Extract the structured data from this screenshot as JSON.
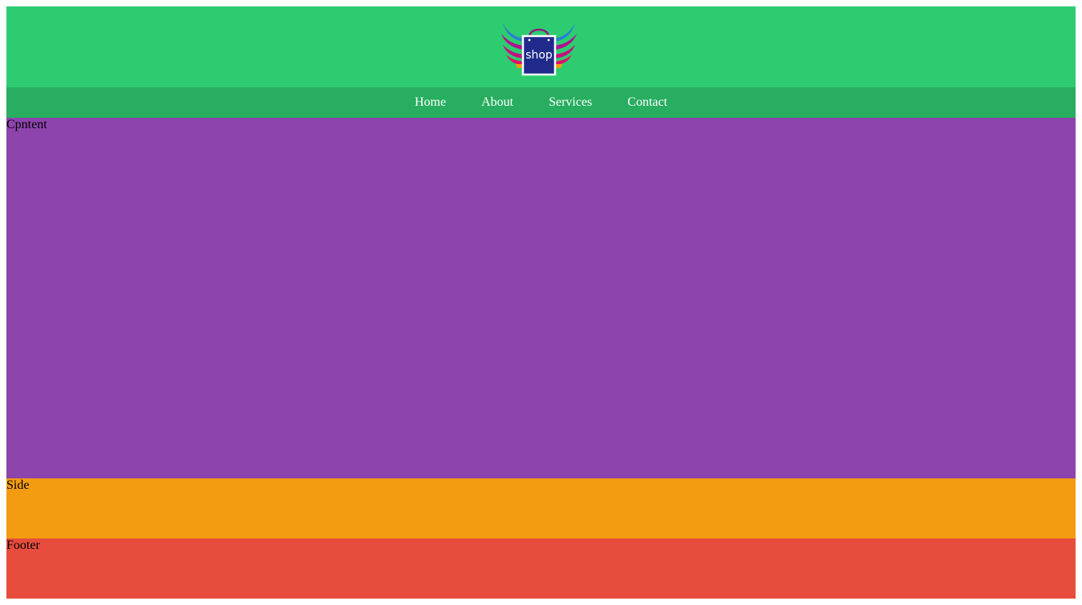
{
  "header": {
    "logo": {
      "text": "shop",
      "icon": "winged-shopping-bag-icon",
      "colors": {
        "bag": "#1f2a8a",
        "bag_border": "#ffffff",
        "handle": "#8e1a7a",
        "wing_top": "#2a7fd4",
        "wing_mid": "#b0108f",
        "wing_low": "#e0106a",
        "wing_tip": "#f39c12"
      }
    }
  },
  "nav": {
    "items": [
      {
        "label": "Home"
      },
      {
        "label": "About"
      },
      {
        "label": "Services"
      },
      {
        "label": "Contact"
      }
    ]
  },
  "main": {
    "content_label": "Cpntent",
    "side_label": "Side",
    "footer_label": "Footer"
  },
  "colors": {
    "header_bg": "#2ecc71",
    "nav_bg": "#27ae60",
    "content_bg": "#8e44ad",
    "side_bg": "#f39c12",
    "footer_bg": "#e74c3c",
    "nav_text": "#ffffff"
  }
}
